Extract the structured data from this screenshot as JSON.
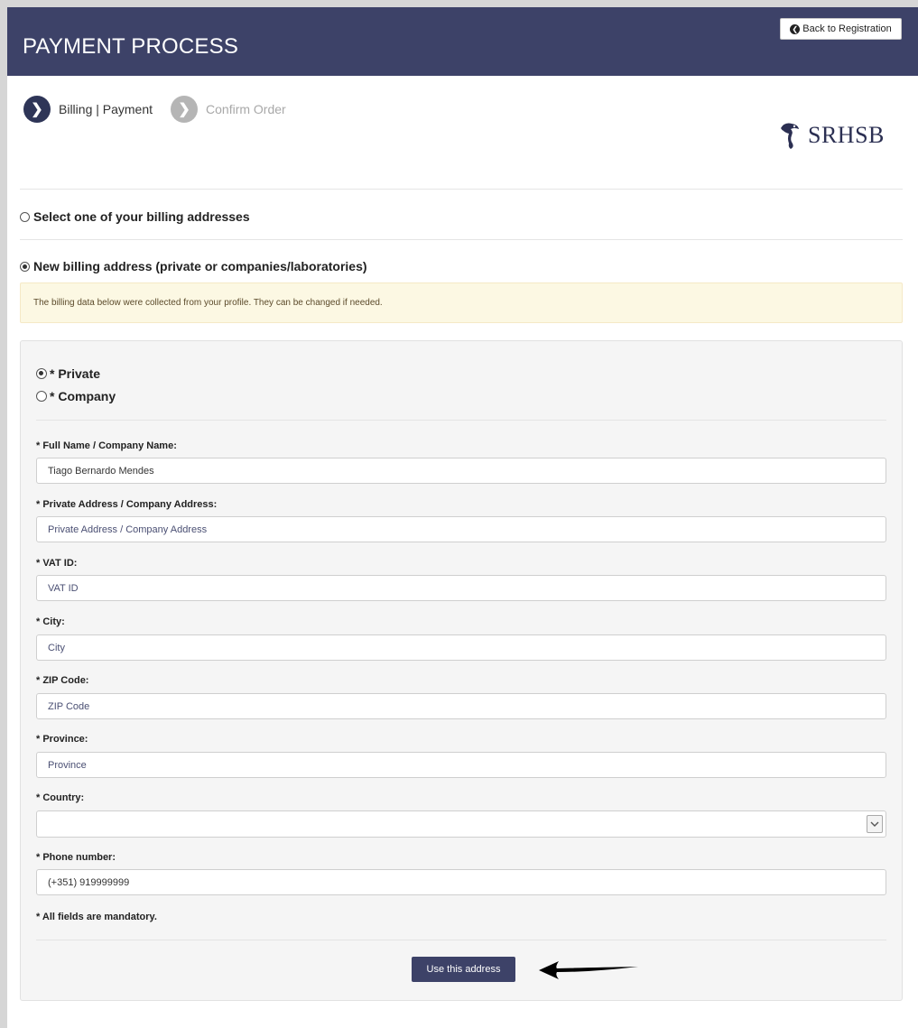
{
  "header": {
    "title": "PAYMENT PROCESS",
    "back_button": "Back to Registration"
  },
  "steps": [
    {
      "label": "Billing | Payment",
      "state": "active"
    },
    {
      "label": "Confirm Order",
      "state": "inactive"
    }
  ],
  "logo": {
    "text": "SRHSB"
  },
  "billing_options": {
    "select_existing": "Select one of your billing addresses",
    "new_address": "New billing address (private or companies/laboratories)",
    "selected": "new_address"
  },
  "notice": "The billing data below were collected from your profile. They can be changed if needed.",
  "entity_type": {
    "private": "* Private",
    "company": "* Company",
    "selected": "private"
  },
  "form": {
    "full_name": {
      "label": "* Full Name / Company Name:",
      "value": "Tiago  Bernardo Mendes"
    },
    "address": {
      "label": "* Private Address / Company Address:",
      "placeholder": "Private Address / Company Address"
    },
    "vat": {
      "label": "* VAT ID:",
      "placeholder": "VAT ID"
    },
    "city": {
      "label": "* City:",
      "placeholder": "City"
    },
    "zip": {
      "label": "* ZIP Code:",
      "placeholder": "ZIP Code"
    },
    "province": {
      "label": "* Province:",
      "placeholder": "Province"
    },
    "country": {
      "label": "* Country:",
      "value": ""
    },
    "phone": {
      "label": "* Phone number:",
      "value": "(+351) 919999999"
    }
  },
  "mandatory_note": "* All fields are mandatory.",
  "submit_button": "Use this address",
  "colors": {
    "header_bg": "#3d4268",
    "notice_bg": "#fcf8e3",
    "button_bg": "#3d4268"
  }
}
